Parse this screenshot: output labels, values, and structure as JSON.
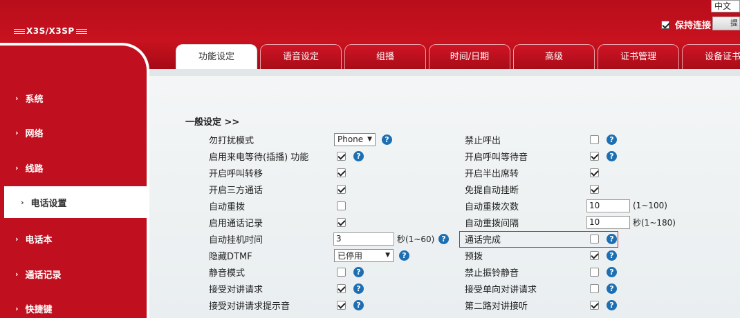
{
  "header": {
    "logo": "X3S/X3SP",
    "language": "中文",
    "keep_connection_label": "保持连接",
    "keep_connection_checked": true,
    "top_button_label": "提"
  },
  "tabs": [
    {
      "label": "功能设定",
      "active": true
    },
    {
      "label": "语音设定",
      "active": false
    },
    {
      "label": "组播",
      "active": false
    },
    {
      "label": "时间/日期",
      "active": false
    },
    {
      "label": "高级",
      "active": false
    },
    {
      "label": "证书管理",
      "active": false
    },
    {
      "label": "设备证书",
      "active": false
    }
  ],
  "sidebar": {
    "items": [
      {
        "label": "系统",
        "active": false
      },
      {
        "label": "网络",
        "active": false
      },
      {
        "label": "线路",
        "active": false
      },
      {
        "label": "电话设置",
        "active": true
      },
      {
        "label": "电话本",
        "active": false
      },
      {
        "label": "通话记录",
        "active": false
      },
      {
        "label": "快捷键",
        "active": false
      }
    ]
  },
  "section": {
    "title": "一般设定 >>"
  },
  "settings": {
    "left": [
      {
        "label": "勿打扰模式",
        "type": "select",
        "value": "Phone",
        "help": true
      },
      {
        "label": "启用来电等待(插播) 功能",
        "type": "checkbox",
        "checked": true,
        "help": true
      },
      {
        "label": "开启呼叫转移",
        "type": "checkbox",
        "checked": true,
        "help": false
      },
      {
        "label": "开启三方通话",
        "type": "checkbox",
        "checked": true,
        "help": false
      },
      {
        "label": "自动重拨",
        "type": "checkbox",
        "checked": false,
        "help": false
      },
      {
        "label": "启用通话记录",
        "type": "checkbox",
        "checked": true,
        "help": false
      },
      {
        "label": "自动挂机时间",
        "type": "text",
        "value": "3",
        "unit": "秒(1~60)",
        "help": true
      },
      {
        "label": "隐藏DTMF",
        "type": "select",
        "value": "已停用",
        "help": true
      },
      {
        "label": "静音模式",
        "type": "checkbox",
        "checked": false,
        "help": true
      },
      {
        "label": "接受对讲请求",
        "type": "checkbox",
        "checked": true,
        "help": true
      },
      {
        "label": "接受对讲请求提示音",
        "type": "checkbox",
        "checked": true,
        "help": true
      }
    ],
    "right": [
      {
        "label": "禁止呼出",
        "type": "checkbox",
        "checked": false,
        "help": true
      },
      {
        "label": "开启呼叫等待音",
        "type": "checkbox",
        "checked": true,
        "help": true
      },
      {
        "label": "开启半出席转",
        "type": "checkbox",
        "checked": true,
        "help": false
      },
      {
        "label": "免提自动挂断",
        "type": "checkbox",
        "checked": true,
        "help": false
      },
      {
        "label": "自动重拨次数",
        "type": "text",
        "value": "10",
        "unit": "(1~100)",
        "help": false
      },
      {
        "label": "自动重拨间隔",
        "type": "text",
        "value": "10",
        "unit": "秒(1~180)",
        "help": false
      },
      {
        "label": "通话完成",
        "type": "checkbox",
        "checked": false,
        "help": true
      },
      {
        "label": "预拨",
        "type": "checkbox",
        "checked": true,
        "help": true
      },
      {
        "label": "禁止振铃静音",
        "type": "checkbox",
        "checked": false,
        "help": true
      },
      {
        "label": "接受单向对讲请求",
        "type": "checkbox",
        "checked": false,
        "help": true
      },
      {
        "label": "第二路对讲接听",
        "type": "checkbox",
        "checked": true,
        "help": true
      }
    ]
  },
  "help_symbol": "?"
}
